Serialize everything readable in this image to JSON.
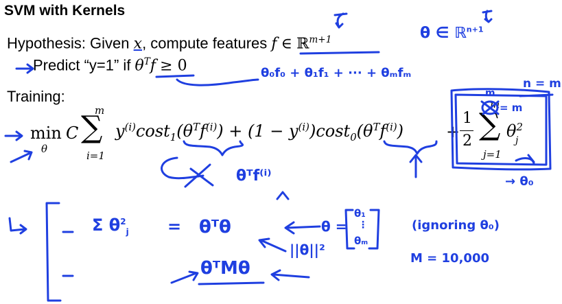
{
  "slide": {
    "title": "SVM with Kernels",
    "hypothesis": {
      "prefix": "Hypothesis: Given ",
      "x": "x",
      "mid": ", compute features ",
      "f_in": "f",
      "in": "∈",
      "R": "ℝ",
      "R_sup": "m+1"
    },
    "predict": {
      "text": "Predict “y=1” if ",
      "theta": "θ",
      "T": "T",
      "f": "f",
      "geq": "≥ 0"
    },
    "training": {
      "label": "Training:",
      "min": "min",
      "theta": "θ",
      "C": "C",
      "sum_top": "m",
      "sum_bottom": "i=1",
      "term1": "y",
      "i_sup": "(i)",
      "cost1": "cost",
      "cost1_sub": "1",
      "theta_T_f": "(θ",
      "T": "T",
      "f_i": "f",
      "close": ")",
      "plus_1": " + (1 − y",
      "close2": ")",
      "cost0": "cost",
      "cost0_sub": "0",
      "plus": "+",
      "half_num": "1",
      "half_den": "2",
      "sum2_top": "m",
      "sum2_bottom": "j=1",
      "theta_j": "θ",
      "j_sub": "j",
      "sq": "2"
    }
  },
  "annotations": {
    "theta_in_R": "θ ∈ ℝ",
    "theta_in_R_sup": "n+1",
    "expansion": "θ₀f₀ + θ₁f₁ + ··· + θₘfₘ",
    "n_eq_m": "n = m",
    "box_m": "m",
    "box_eq": "= m",
    "theta_T_f_i": "θᵀf⁽ⁱ⁾",
    "theta0": "→ θ₀",
    "sum_label": "Σ θ",
    "sum_sub": "j",
    "sum_sup": "2",
    "eq": "=",
    "theta_T_theta": "θᵀθ",
    "theta_eq": "θ =",
    "vec_top": "θ₁",
    "vec_dots": "⋮",
    "vec_bottom": "θₘ",
    "norm": "||θ||²",
    "ignoring": "(ignoring θ₀)",
    "m_val": "M = 10,000",
    "theta_M_theta": "θᵀMθ"
  }
}
